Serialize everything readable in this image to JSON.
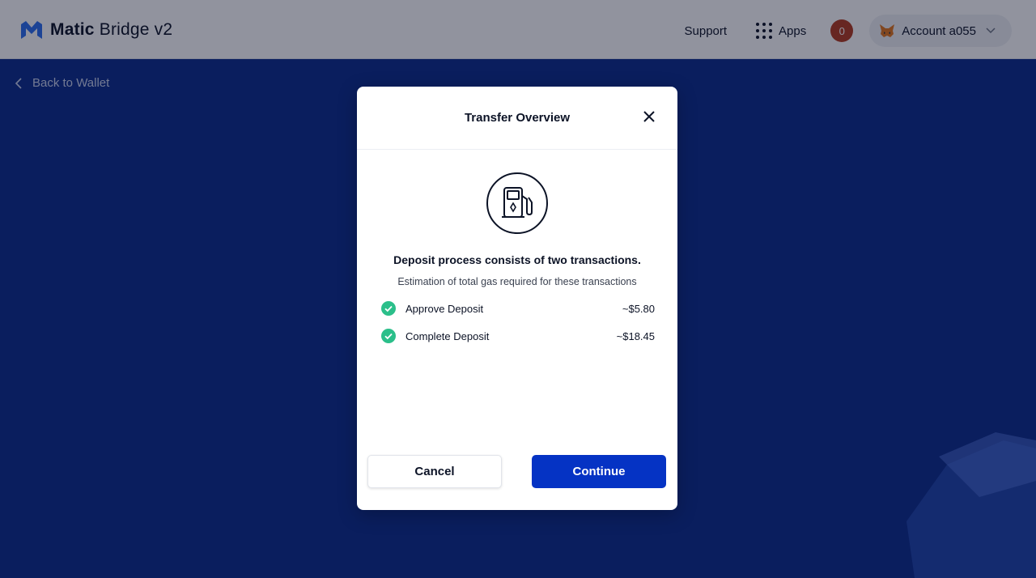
{
  "header": {
    "brand_bold": "Matic",
    "brand_rest": "Bridge v2",
    "support_label": "Support",
    "apps_label": "Apps",
    "notification_count": "0",
    "account_label": "Account a055"
  },
  "back": {
    "label": "Back to Wallet"
  },
  "modal": {
    "title": "Transfer Overview",
    "headline": "Deposit process consists of two transactions.",
    "subline": "Estimation of total gas required for these transactions",
    "transactions": [
      {
        "label": "Approve Deposit",
        "cost": "~$5.80"
      },
      {
        "label": "Complete Deposit",
        "cost": "~$18.45"
      }
    ],
    "cancel_label": "Cancel",
    "continue_label": "Continue"
  },
  "colors": {
    "page_background": "#0a2a8a",
    "primary_button": "#0533c4",
    "check_green": "#2bbf8a",
    "notification_badge": "#b23a1e"
  },
  "icons": [
    "matic-logo-icon",
    "apps-grid-icon",
    "metamask-fox-icon",
    "chevron-down-icon",
    "chevron-left-icon",
    "close-icon",
    "gas-pump-icon",
    "check-circle-icon"
  ]
}
